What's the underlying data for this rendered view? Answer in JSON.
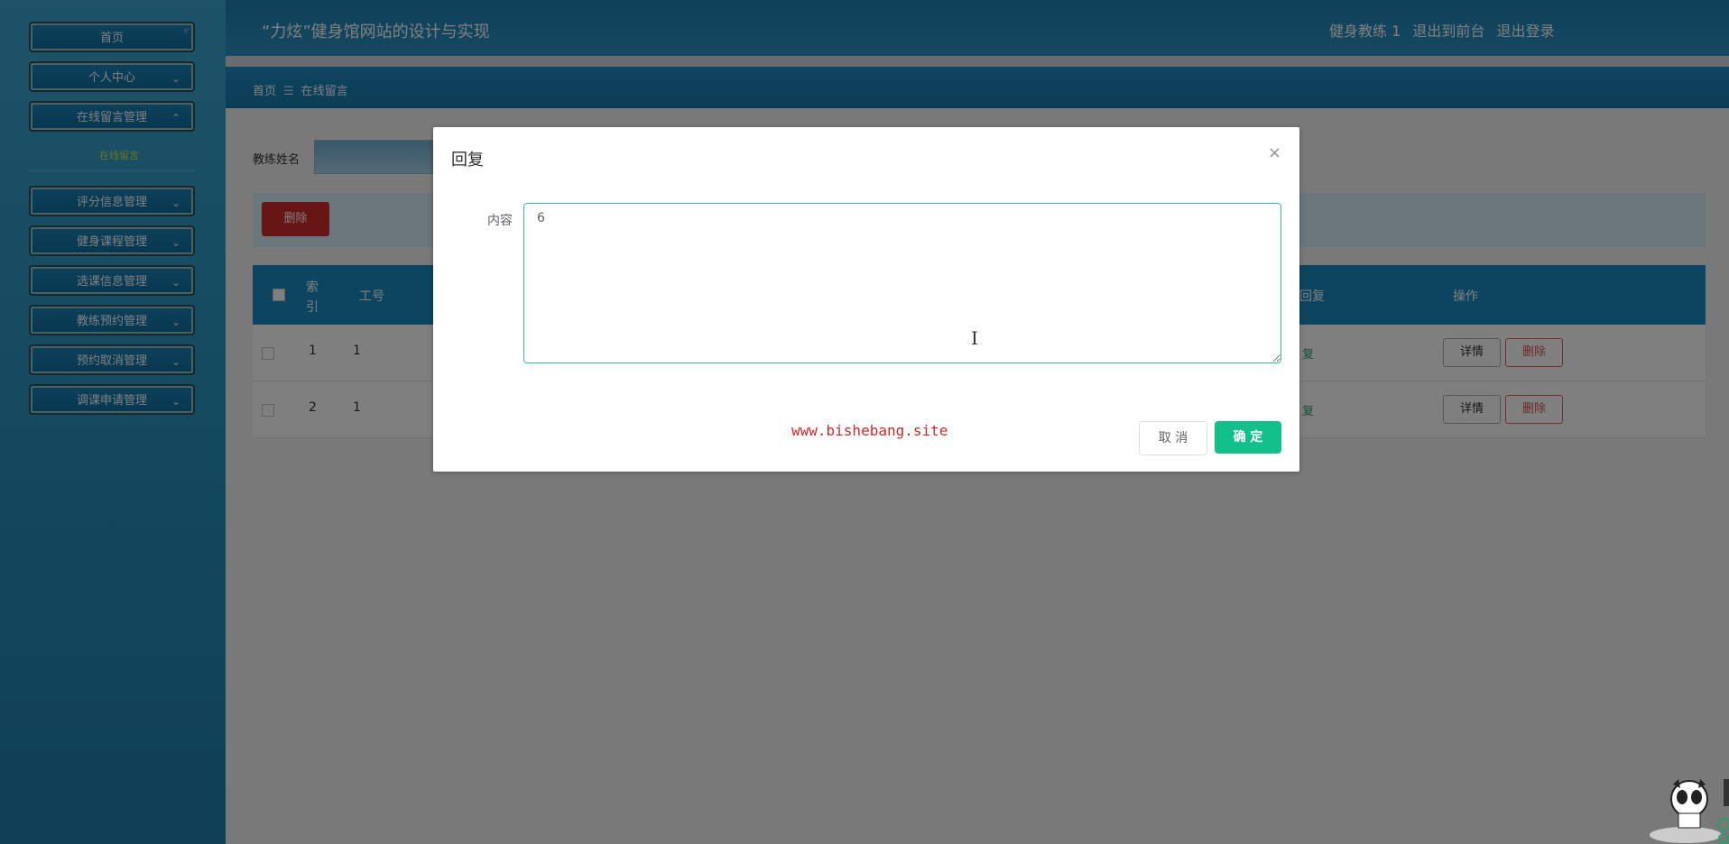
{
  "sidebar": {
    "items": [
      {
        "label": "首页"
      },
      {
        "label": "个人中心"
      },
      {
        "label": "在线留言管理"
      },
      {
        "label": "评分信息管理"
      },
      {
        "label": "健身课程管理"
      },
      {
        "label": "选课信息管理"
      },
      {
        "label": "教练预约管理"
      },
      {
        "label": "预约取消管理"
      },
      {
        "label": "调课申请管理"
      }
    ],
    "submenu": "在线留言"
  },
  "header": {
    "title": "“力炫”健身馆网站的设计与实现",
    "user": "健身教练 1",
    "to_front": "退出到前台",
    "logout": "退出登录"
  },
  "breadcrumb": {
    "home": "首页",
    "current": "在线留言"
  },
  "search": {
    "coach_label": "教练姓名"
  },
  "toolbar": {
    "delete_label": "删除"
  },
  "table": {
    "headers": {
      "index": "索引",
      "job_no": "工号",
      "reply": "回复",
      "action": "操作"
    },
    "rows": [
      {
        "index": "1",
        "job_no": "1",
        "reply": "复",
        "detail": "详情",
        "delete": "删除"
      },
      {
        "index": "2",
        "job_no": "1",
        "reply": "复",
        "detail": "详情",
        "delete": "删除"
      }
    ]
  },
  "dialog": {
    "title": "回复",
    "close": "×",
    "content_label": "内容",
    "content_value": "6",
    "watermark": "www.bishebang.site",
    "cancel": "取 消",
    "confirm": "确 定"
  },
  "colors": {
    "accent": "#13c08a",
    "danger": "#d12a2a",
    "header": "#1a8ac2"
  }
}
